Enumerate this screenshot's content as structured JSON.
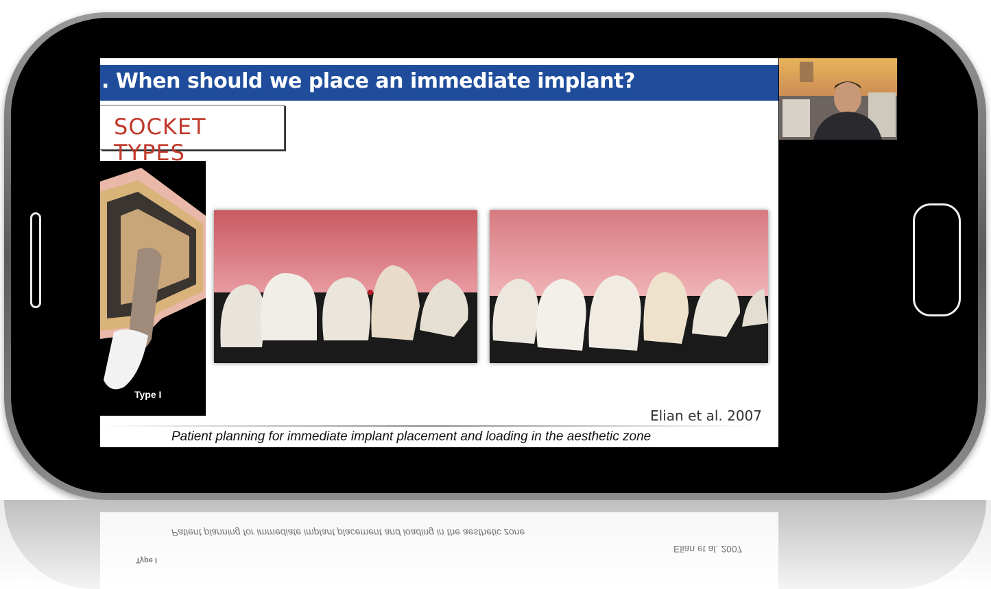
{
  "slide": {
    "title": ". When should we place an immediate implant?",
    "section_heading": "SOCKET TYPES",
    "diagram_label": "Type I",
    "credit": "Elian et al. 2007",
    "caption": "Patient planning for immediate implant placement and loading in the aesthetic zone"
  },
  "colors": {
    "title_bar": "#1f4d9c",
    "section_heading": "#c0392b"
  },
  "icons": {
    "left_button": "side-button-icon",
    "home_button": "home-button-icon"
  }
}
